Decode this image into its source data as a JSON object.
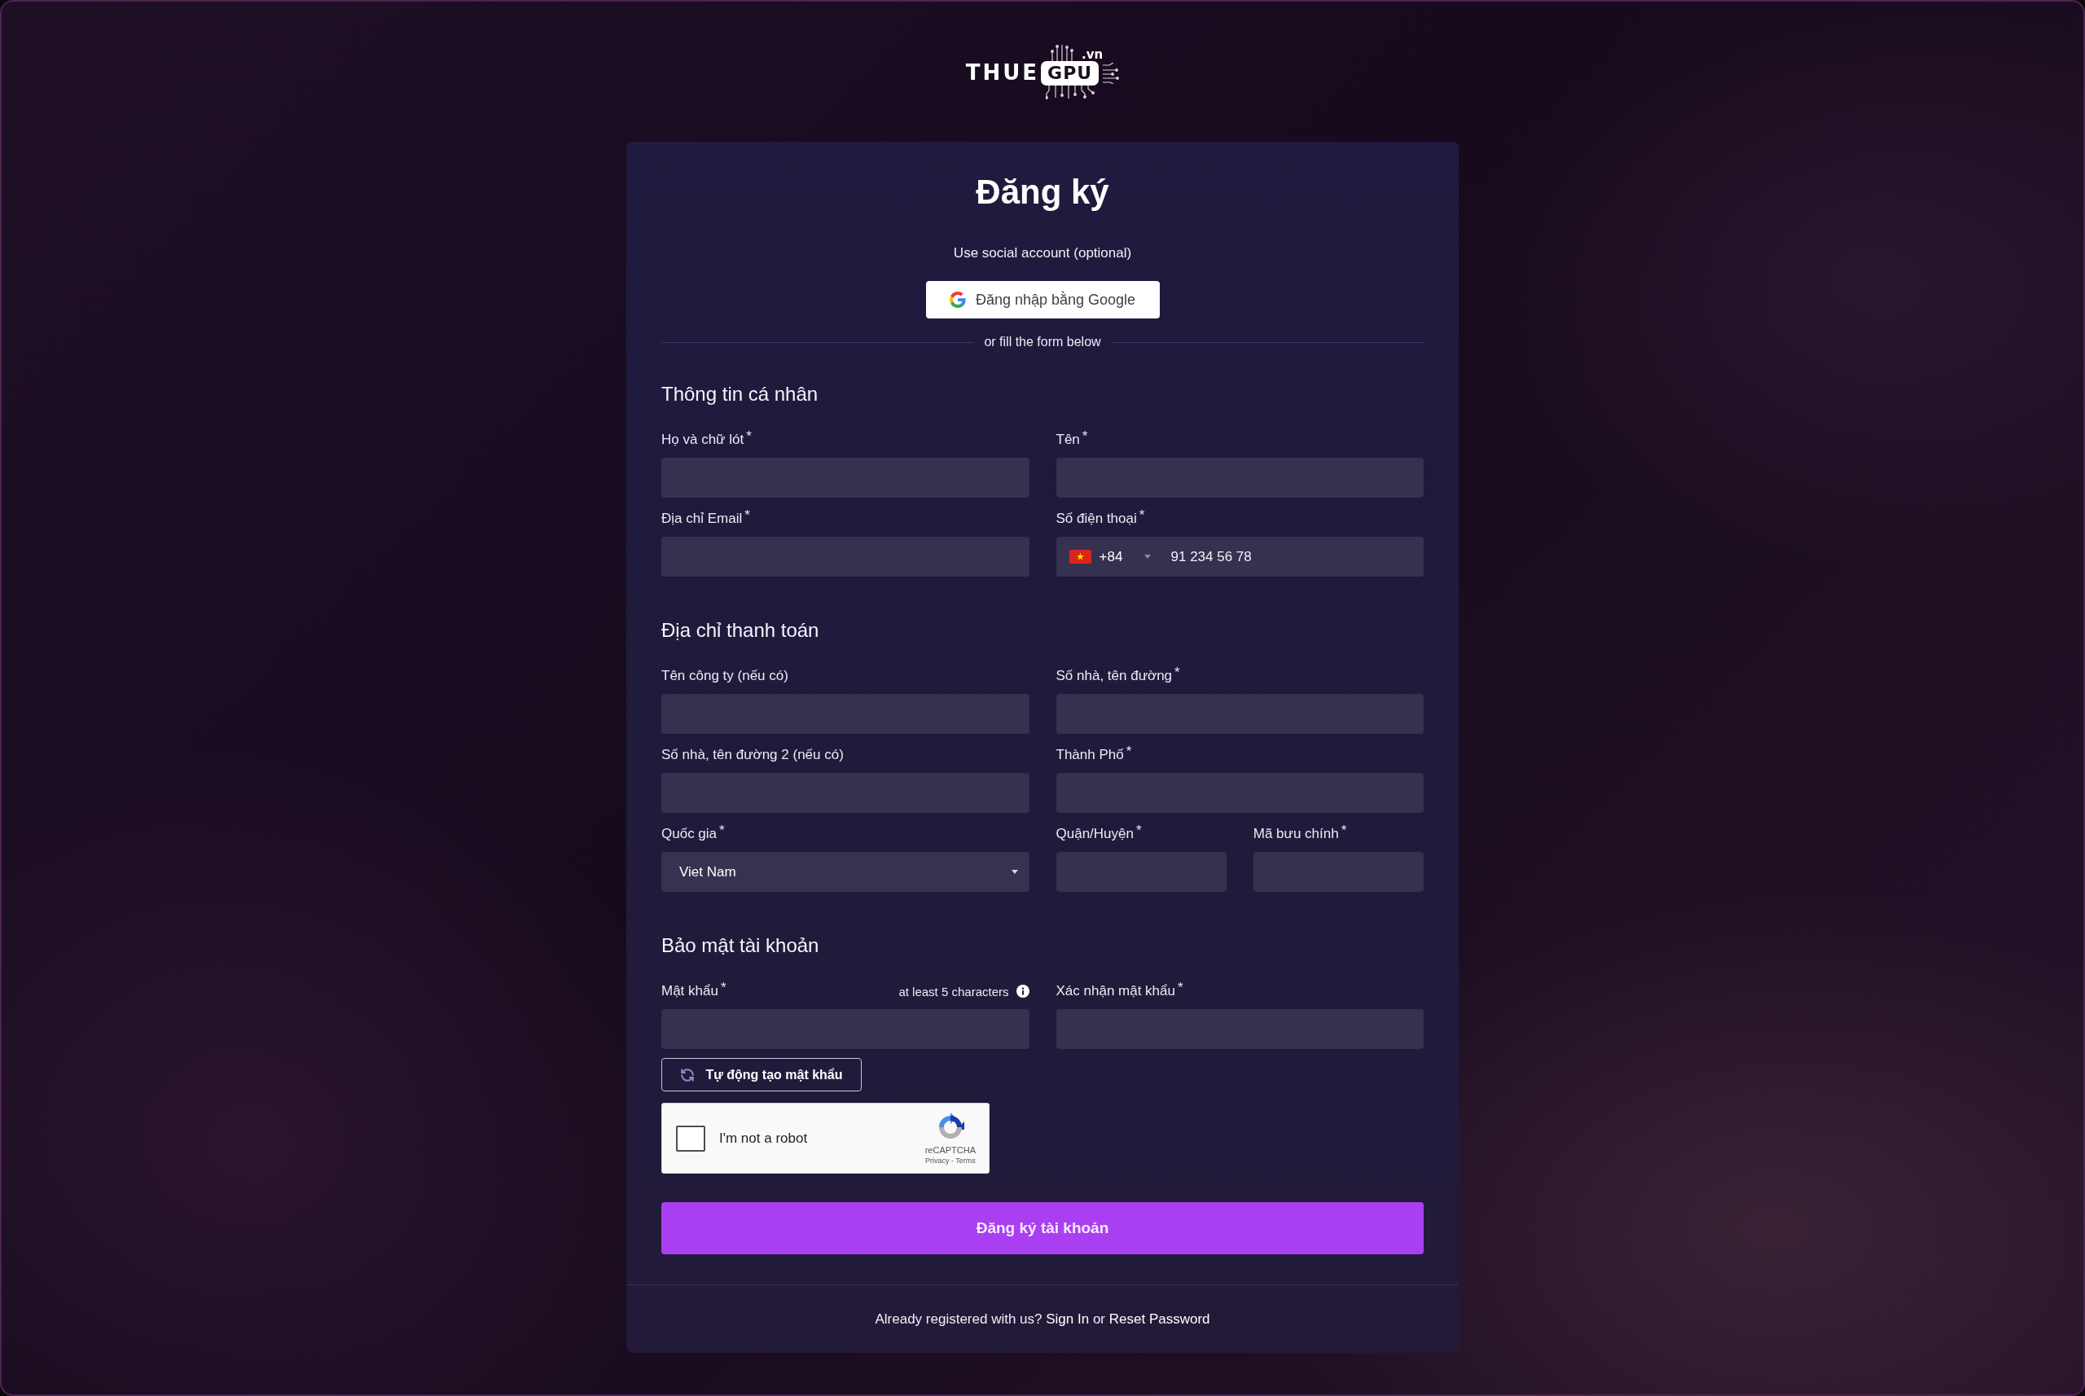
{
  "logo": {
    "wordmark": "THUE",
    "highlight": "GPU",
    "domain": ".vn"
  },
  "title": "Đăng ký",
  "social": {
    "prompt": "Use social account (optional)",
    "google_button": "Đăng nhập bằng Google"
  },
  "divider_text": "or fill the form below",
  "sections": [
    {
      "title": "Thông tin cá nhân",
      "rows": [
        {
          "fields": [
            {
              "kind": "text",
              "label": "Họ và chữ lót$^{*}$"
            },
            {
              "kind": "text",
              "label": "Tên$^{*}$"
            }
          ]
        },
        {
          "fields": [
            {
              "kind": "text",
              "label": "Địa chỉ Email$^{*}$"
            },
            {
              "kind": "phone",
              "label": "Số điện thoại$^{*}$",
              "country_code": "+84",
              "placeholder": "91 234 56 78"
            }
          ]
        }
      ]
    },
    {
      "title": "Địa chỉ thanh toán",
      "rows": [
        {
          "fields": [
            {
              "kind": "text",
              "label": "Tên công ty (nếu có)"
            },
            {
              "kind": "text",
              "label": "Số nhà, tên đường$^{*}$"
            }
          ]
        },
        {
          "fields": [
            {
              "kind": "text",
              "label": "Số nhà, tên đường 2 (nếu có)"
            },
            {
              "kind": "text",
              "label": "Thành Phố$^{*}$"
            }
          ]
        },
        {
          "fields": [
            {
              "kind": "select",
              "label": "Quốc gia$^{*}$",
              "value": "Viet Nam"
            },
            {
              "kind": "text",
              "label": "Quận/Huyện$^{*}$"
            },
            {
              "kind": "text",
              "label": "Mã bưu chính$^{*}$"
            }
          ]
        }
      ]
    },
    {
      "title": "Bảo mật tài khoản",
      "rows": [
        {
          "fields": [
            {
              "kind": "password",
              "label": "Mật khẩu$^{*}$",
              "hint": "at least 5 characters"
            },
            {
              "kind": "password",
              "label": "Xác nhận mật khẩu$^{*}$"
            }
          ]
        }
      ]
    }
  ],
  "generate_button": "Tự động tạo mật khẩu",
  "captcha": {
    "checked": false,
    "label": "I'm not a robot",
    "brand": "reCAPTCHA",
    "links": "Privacy - Terms"
  },
  "submit_button": "Đăng ký tài khoản",
  "footer": [
    {
      "kind": "text",
      "text": "Already registered with us?"
    },
    {
      "kind": "link",
      "text": "Sign In"
    },
    {
      "kind": "text",
      "text": "or"
    },
    {
      "kind": "link",
      "text": "Reset Password"
    }
  ]
}
